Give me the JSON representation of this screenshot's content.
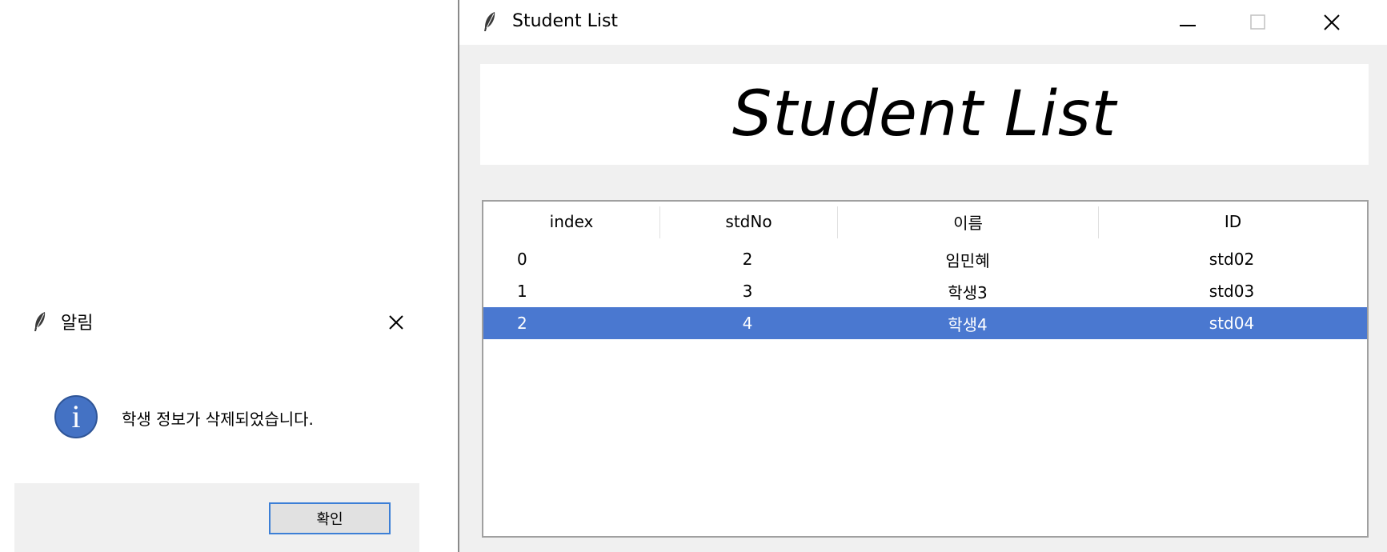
{
  "dialog": {
    "title": "알림",
    "message": "학생 정보가 삭제되었습니다.",
    "ok_label": "확인",
    "info_glyph": "i",
    "icon": "info-icon",
    "accent": "#4472c4"
  },
  "window": {
    "title": "Student List",
    "heading": "Student List"
  },
  "table": {
    "columns": [
      "index",
      "stdNo",
      "이름",
      "ID"
    ],
    "rows": [
      {
        "index": "0",
        "stdNo": "2",
        "name": "임민혜",
        "id": "std02"
      },
      {
        "index": "1",
        "stdNo": "3",
        "name": "학생3",
        "id": "std03"
      },
      {
        "index": "2",
        "stdNo": "4",
        "name": "학생4",
        "id": "std04"
      }
    ],
    "selected_row_index": 2,
    "selection_color": "#4a78d0"
  }
}
